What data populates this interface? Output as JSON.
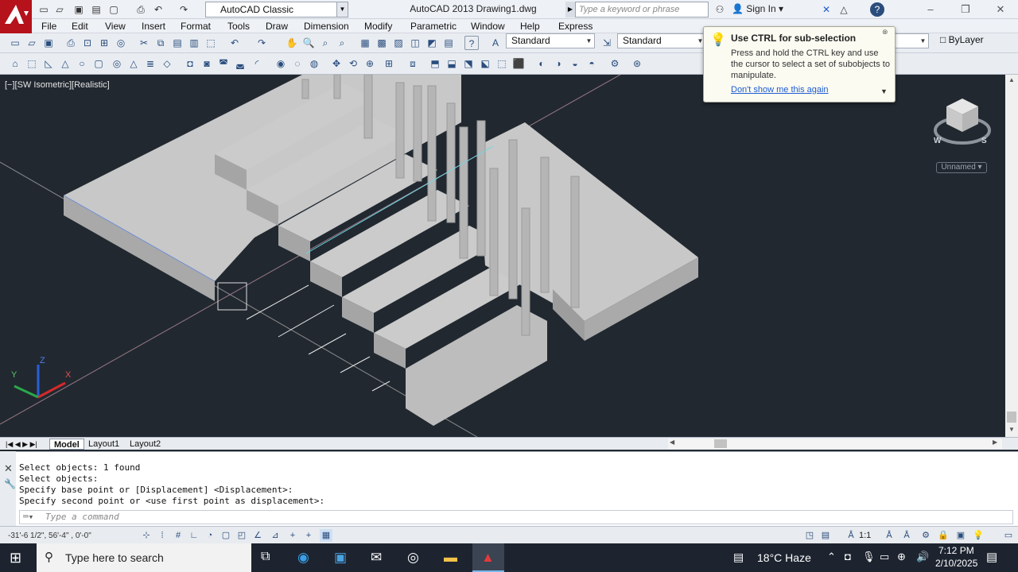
{
  "titlebar": {
    "workspace": "AutoCAD Classic",
    "title": "AutoCAD 2013    Drawing1.dwg",
    "search_placeholder": "Type a keyword or phrase",
    "sign_in": "Sign In"
  },
  "menubar": {
    "items": [
      "File",
      "Edit",
      "View",
      "Insert",
      "Format",
      "Tools",
      "Draw",
      "Dimension",
      "Modify",
      "Parametric",
      "Window",
      "Help",
      "Express"
    ]
  },
  "toolbar": {
    "text_style": "Standard",
    "dim_style": "Standard",
    "table_style": "Standard",
    "layer_color": "ByLayer"
  },
  "viewport": {
    "label": "[−][SW Isometric][Realistic]",
    "wcs": "Unnamed",
    "axis_z": "Z",
    "axis_x": "X",
    "axis_y": "Y",
    "compass": {
      "w": "W",
      "s": "S"
    }
  },
  "tooltip": {
    "title": "Use CTRL for sub-selection",
    "body": "Press and hold the CTRL key and use the cursor to select a set of subobjects to manipulate.",
    "link": "Don't show me this again"
  },
  "tabs": [
    "Model",
    "Layout1",
    "Layout2"
  ],
  "command": {
    "history": [
      "Select objects: 1 found",
      "Select objects:",
      "Specify base point or [Displacement] <Displacement>:",
      "Specify second point or <use first point as displacement>:"
    ],
    "placeholder": "Type a command"
  },
  "status": {
    "coords": "-31'-6 1/2\", 56'-4\"   , 0'-0\"",
    "scale": "1:1"
  },
  "taskbar": {
    "search_placeholder": "Type here to search",
    "weather": "18°C  Haze",
    "time": "7:12 PM",
    "date": "2/10/2025"
  },
  "colors": {
    "viewport_bg": "#212830",
    "accent_red": "#b5121b",
    "link_blue": "#1d5bd1"
  }
}
